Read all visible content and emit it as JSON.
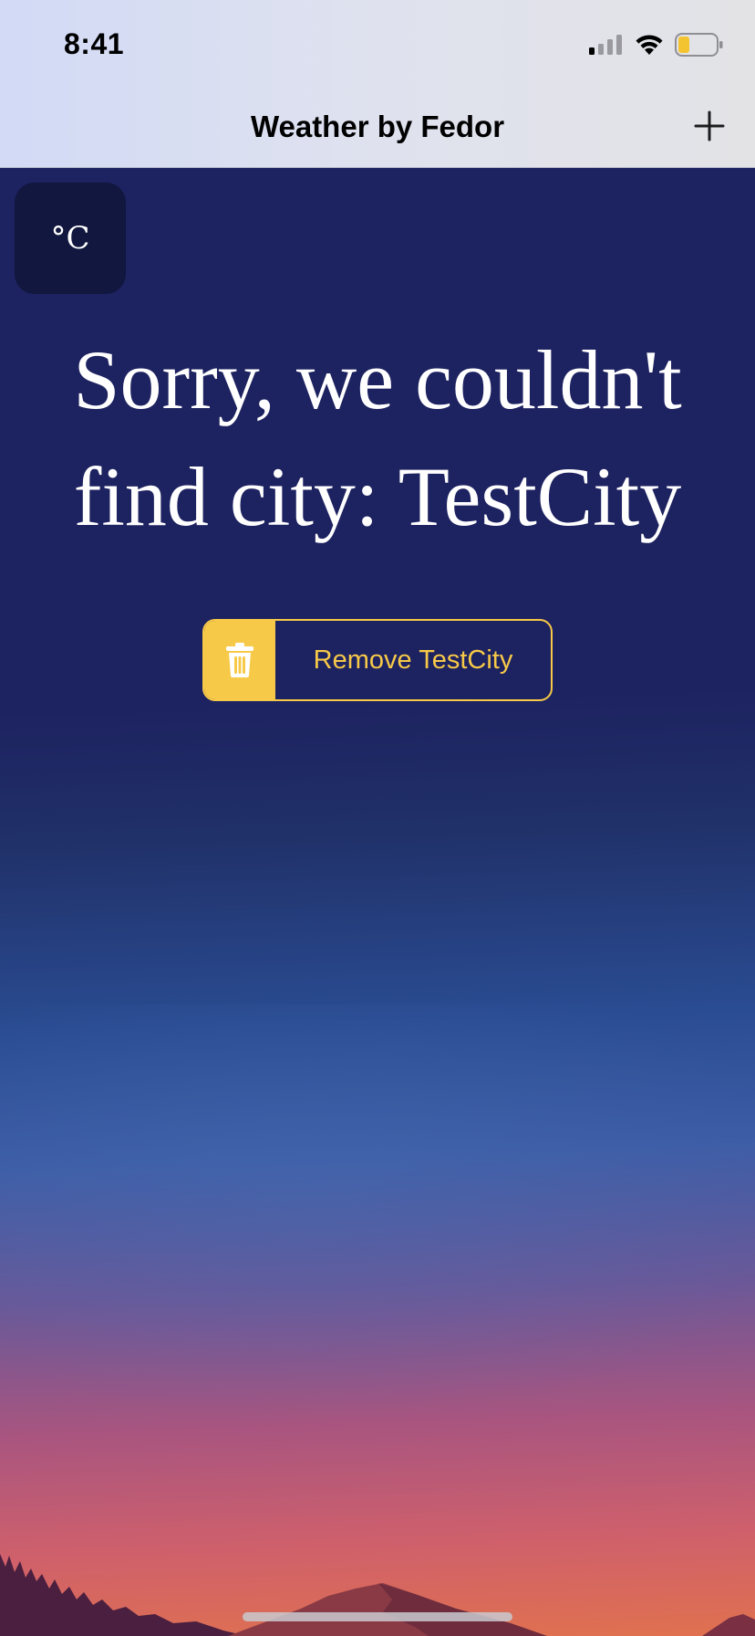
{
  "status_bar": {
    "time": "8:41"
  },
  "nav": {
    "title": "Weather by Fedor",
    "add_icon": "plus-icon"
  },
  "unit_toggle": {
    "label": "°C"
  },
  "error": {
    "message": "Sorry, we couldn't find city: TestCity"
  },
  "remove_button": {
    "label": "Remove TestCity",
    "icon": "trash-icon"
  },
  "colors": {
    "accent": "#f7c948",
    "background_top": "#1d2260",
    "background_bottom": "#e0714f",
    "toggle_bg": "#11173e"
  }
}
